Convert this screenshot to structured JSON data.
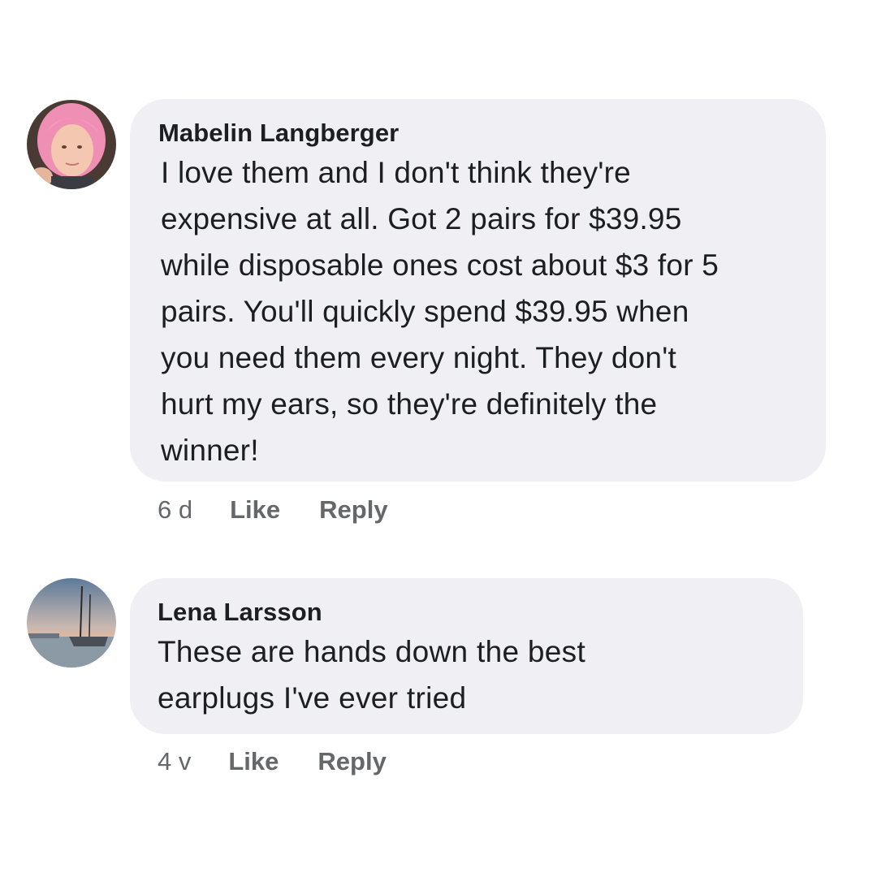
{
  "comments": [
    {
      "author": "Mabelin Langberger",
      "text": "I love them and I don't think they're\nexpensive at all. Got 2 pairs for $39.95\nwhile disposable ones cost about $3 for 5\npairs. You'll quickly spend $39.95 when\nyou need them every night. They don't\nhurt my ears, so they're definitely the\nwinner!",
      "time": "6 d",
      "like_label": "Like",
      "reply_label": "Reply",
      "avatar_icon": "profile-photo-pink-hair"
    },
    {
      "author": "Lena Larsson",
      "text": "These are hands down the best\nearplugs I've ever tried",
      "time": "4 v",
      "like_label": "Like",
      "reply_label": "Reply",
      "avatar_icon": "profile-photo-sailboat"
    }
  ],
  "colors": {
    "bubble": "#f0f0f4",
    "text": "#1c1e21",
    "meta": "#65676b"
  }
}
